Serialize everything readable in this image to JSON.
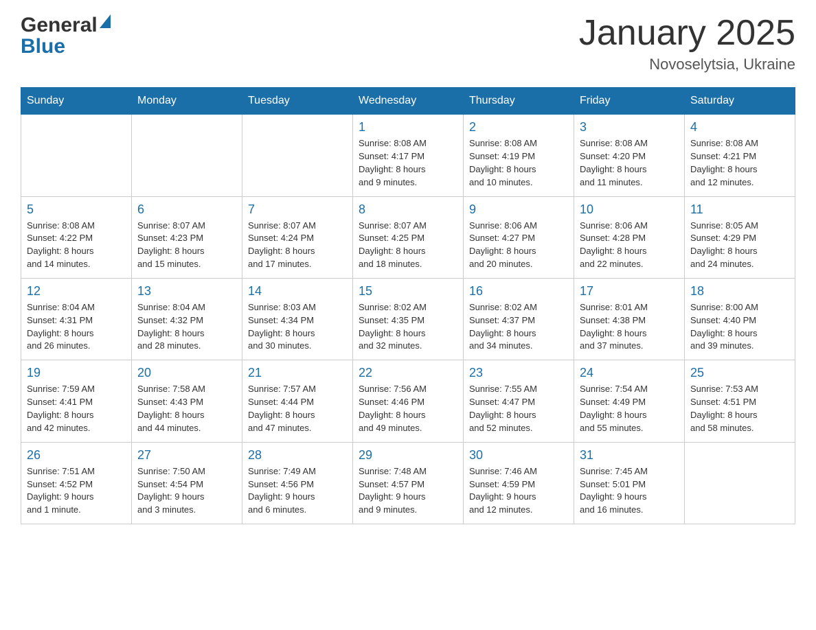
{
  "header": {
    "logo": {
      "line1": "General",
      "line2": "Blue"
    },
    "title": "January 2025",
    "subtitle": "Novoselytsia, Ukraine"
  },
  "days_of_week": [
    "Sunday",
    "Monday",
    "Tuesday",
    "Wednesday",
    "Thursday",
    "Friday",
    "Saturday"
  ],
  "weeks": [
    [
      {
        "day": "",
        "info": ""
      },
      {
        "day": "",
        "info": ""
      },
      {
        "day": "",
        "info": ""
      },
      {
        "day": "1",
        "info": "Sunrise: 8:08 AM\nSunset: 4:17 PM\nDaylight: 8 hours\nand 9 minutes."
      },
      {
        "day": "2",
        "info": "Sunrise: 8:08 AM\nSunset: 4:19 PM\nDaylight: 8 hours\nand 10 minutes."
      },
      {
        "day": "3",
        "info": "Sunrise: 8:08 AM\nSunset: 4:20 PM\nDaylight: 8 hours\nand 11 minutes."
      },
      {
        "day": "4",
        "info": "Sunrise: 8:08 AM\nSunset: 4:21 PM\nDaylight: 8 hours\nand 12 minutes."
      }
    ],
    [
      {
        "day": "5",
        "info": "Sunrise: 8:08 AM\nSunset: 4:22 PM\nDaylight: 8 hours\nand 14 minutes."
      },
      {
        "day": "6",
        "info": "Sunrise: 8:07 AM\nSunset: 4:23 PM\nDaylight: 8 hours\nand 15 minutes."
      },
      {
        "day": "7",
        "info": "Sunrise: 8:07 AM\nSunset: 4:24 PM\nDaylight: 8 hours\nand 17 minutes."
      },
      {
        "day": "8",
        "info": "Sunrise: 8:07 AM\nSunset: 4:25 PM\nDaylight: 8 hours\nand 18 minutes."
      },
      {
        "day": "9",
        "info": "Sunrise: 8:06 AM\nSunset: 4:27 PM\nDaylight: 8 hours\nand 20 minutes."
      },
      {
        "day": "10",
        "info": "Sunrise: 8:06 AM\nSunset: 4:28 PM\nDaylight: 8 hours\nand 22 minutes."
      },
      {
        "day": "11",
        "info": "Sunrise: 8:05 AM\nSunset: 4:29 PM\nDaylight: 8 hours\nand 24 minutes."
      }
    ],
    [
      {
        "day": "12",
        "info": "Sunrise: 8:04 AM\nSunset: 4:31 PM\nDaylight: 8 hours\nand 26 minutes."
      },
      {
        "day": "13",
        "info": "Sunrise: 8:04 AM\nSunset: 4:32 PM\nDaylight: 8 hours\nand 28 minutes."
      },
      {
        "day": "14",
        "info": "Sunrise: 8:03 AM\nSunset: 4:34 PM\nDaylight: 8 hours\nand 30 minutes."
      },
      {
        "day": "15",
        "info": "Sunrise: 8:02 AM\nSunset: 4:35 PM\nDaylight: 8 hours\nand 32 minutes."
      },
      {
        "day": "16",
        "info": "Sunrise: 8:02 AM\nSunset: 4:37 PM\nDaylight: 8 hours\nand 34 minutes."
      },
      {
        "day": "17",
        "info": "Sunrise: 8:01 AM\nSunset: 4:38 PM\nDaylight: 8 hours\nand 37 minutes."
      },
      {
        "day": "18",
        "info": "Sunrise: 8:00 AM\nSunset: 4:40 PM\nDaylight: 8 hours\nand 39 minutes."
      }
    ],
    [
      {
        "day": "19",
        "info": "Sunrise: 7:59 AM\nSunset: 4:41 PM\nDaylight: 8 hours\nand 42 minutes."
      },
      {
        "day": "20",
        "info": "Sunrise: 7:58 AM\nSunset: 4:43 PM\nDaylight: 8 hours\nand 44 minutes."
      },
      {
        "day": "21",
        "info": "Sunrise: 7:57 AM\nSunset: 4:44 PM\nDaylight: 8 hours\nand 47 minutes."
      },
      {
        "day": "22",
        "info": "Sunrise: 7:56 AM\nSunset: 4:46 PM\nDaylight: 8 hours\nand 49 minutes."
      },
      {
        "day": "23",
        "info": "Sunrise: 7:55 AM\nSunset: 4:47 PM\nDaylight: 8 hours\nand 52 minutes."
      },
      {
        "day": "24",
        "info": "Sunrise: 7:54 AM\nSunset: 4:49 PM\nDaylight: 8 hours\nand 55 minutes."
      },
      {
        "day": "25",
        "info": "Sunrise: 7:53 AM\nSunset: 4:51 PM\nDaylight: 8 hours\nand 58 minutes."
      }
    ],
    [
      {
        "day": "26",
        "info": "Sunrise: 7:51 AM\nSunset: 4:52 PM\nDaylight: 9 hours\nand 1 minute."
      },
      {
        "day": "27",
        "info": "Sunrise: 7:50 AM\nSunset: 4:54 PM\nDaylight: 9 hours\nand 3 minutes."
      },
      {
        "day": "28",
        "info": "Sunrise: 7:49 AM\nSunset: 4:56 PM\nDaylight: 9 hours\nand 6 minutes."
      },
      {
        "day": "29",
        "info": "Sunrise: 7:48 AM\nSunset: 4:57 PM\nDaylight: 9 hours\nand 9 minutes."
      },
      {
        "day": "30",
        "info": "Sunrise: 7:46 AM\nSunset: 4:59 PM\nDaylight: 9 hours\nand 12 minutes."
      },
      {
        "day": "31",
        "info": "Sunrise: 7:45 AM\nSunset: 5:01 PM\nDaylight: 9 hours\nand 16 minutes."
      },
      {
        "day": "",
        "info": ""
      }
    ]
  ]
}
